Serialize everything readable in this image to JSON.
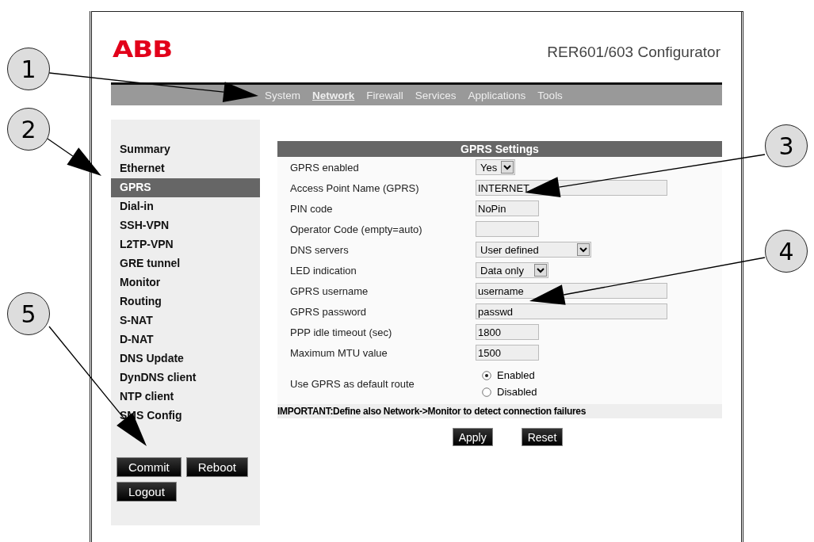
{
  "header": {
    "logo": "ABB",
    "title": "RER601/603 Configurator"
  },
  "nav": [
    {
      "label": "System",
      "selected": false
    },
    {
      "label": "Network",
      "selected": true
    },
    {
      "label": "Firewall",
      "selected": false
    },
    {
      "label": "Services",
      "selected": false
    },
    {
      "label": "Applications",
      "selected": false
    },
    {
      "label": "Tools",
      "selected": false
    }
  ],
  "sidebar": {
    "items": [
      {
        "label": "Summary",
        "selected": false
      },
      {
        "label": "Ethernet",
        "selected": false
      },
      {
        "label": "GPRS",
        "selected": true
      },
      {
        "label": "Dial-in",
        "selected": false
      },
      {
        "label": "SSH-VPN",
        "selected": false
      },
      {
        "label": "L2TP-VPN",
        "selected": false
      },
      {
        "label": "GRE tunnel",
        "selected": false
      },
      {
        "label": "Monitor",
        "selected": false
      },
      {
        "label": "Routing",
        "selected": false
      },
      {
        "label": "S-NAT",
        "selected": false
      },
      {
        "label": "D-NAT",
        "selected": false
      },
      {
        "label": "DNS Update",
        "selected": false
      },
      {
        "label": "DynDNS client",
        "selected": false
      },
      {
        "label": "NTP client",
        "selected": false
      },
      {
        "label": "SMS Config",
        "selected": false
      }
    ],
    "buttons": [
      "Commit",
      "Reboot",
      "Logout"
    ]
  },
  "form": {
    "title": "GPRS Settings",
    "rows": [
      {
        "kind": "select",
        "label": "GPRS enabled",
        "value": "Yes"
      },
      {
        "kind": "text",
        "label": "Access Point Name (GPRS)",
        "value": "INTERNET"
      },
      {
        "kind": "text",
        "label": "PIN code",
        "value": "NoPin"
      },
      {
        "kind": "text",
        "label": "Operator Code (empty=auto)"
      },
      {
        "kind": "select",
        "label": "DNS servers",
        "value": "User defined"
      },
      {
        "kind": "select",
        "label": "LED indication",
        "value": "Data only"
      },
      {
        "kind": "text",
        "label": "GPRS username",
        "value": "username"
      },
      {
        "kind": "text",
        "label": "GPRS password",
        "value": "passwd"
      },
      {
        "kind": "text",
        "label": "PPP idle timeout (sec)",
        "value": "1800"
      },
      {
        "kind": "text",
        "label": "Maximum MTU value",
        "value": "1500"
      },
      {
        "kind": "radio",
        "label": "Use GPRS as default route",
        "options": [
          {
            "label": "Enabled",
            "selected": true
          },
          {
            "label": "Disabled",
            "selected": false
          }
        ]
      }
    ],
    "note": "IMPORTANT:Define also Network->Monitor to detect connection failures",
    "buttons": [
      "Apply",
      "Reset"
    ]
  },
  "callouts": [
    "1",
    "2",
    "3",
    "4",
    "5"
  ]
}
